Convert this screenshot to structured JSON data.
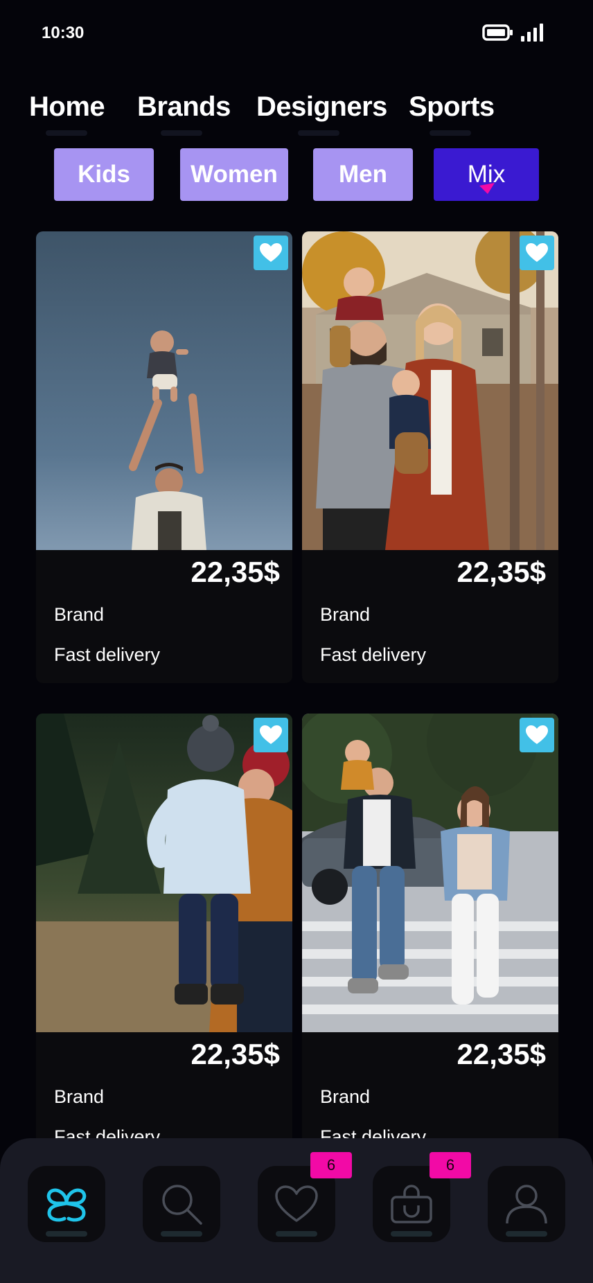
{
  "status_bar": {
    "time": "10:30"
  },
  "nav_tabs": [
    {
      "label": "Home"
    },
    {
      "label": "Brands"
    },
    {
      "label": "Designers"
    },
    {
      "label": "Sports"
    }
  ],
  "filters": [
    {
      "label": "Kids",
      "active": false
    },
    {
      "label": "Women",
      "active": false
    },
    {
      "label": "Men",
      "active": false
    },
    {
      "label": "Mix",
      "active": true
    }
  ],
  "products": [
    {
      "price": "22,35$",
      "brand": "Brand",
      "delivery": "Fast delivery",
      "image": "father-tossing-baby-photo",
      "favorite_icon": "heart-icon"
    },
    {
      "price": "22,35$",
      "brand": "Brand",
      "delivery": "Fast delivery",
      "image": "family-with-two-kids-photo",
      "favorite_icon": "heart-icon"
    },
    {
      "price": "22,35$",
      "brand": "Brand",
      "delivery": "Fast delivery",
      "image": "mother-hugging-child-photo",
      "favorite_icon": "heart-icon"
    },
    {
      "price": "22,35$",
      "brand": "Brand",
      "delivery": "Fast delivery",
      "image": "family-crossing-street-photo",
      "favorite_icon": "heart-icon"
    }
  ],
  "bottom_nav": {
    "items": [
      {
        "icon": "logo-icon",
        "active": true
      },
      {
        "icon": "search-icon"
      },
      {
        "icon": "heart-icon",
        "badge": "6"
      },
      {
        "icon": "bag-icon",
        "badge": "6"
      },
      {
        "icon": "profile-icon"
      }
    ]
  },
  "colors": {
    "background": "#04040a",
    "chip": "#a794f2",
    "chip_active": "#3a1ad1",
    "favorite": "#42c0e7",
    "badge": "#f20aa6",
    "accent": "#1fc4ea"
  }
}
